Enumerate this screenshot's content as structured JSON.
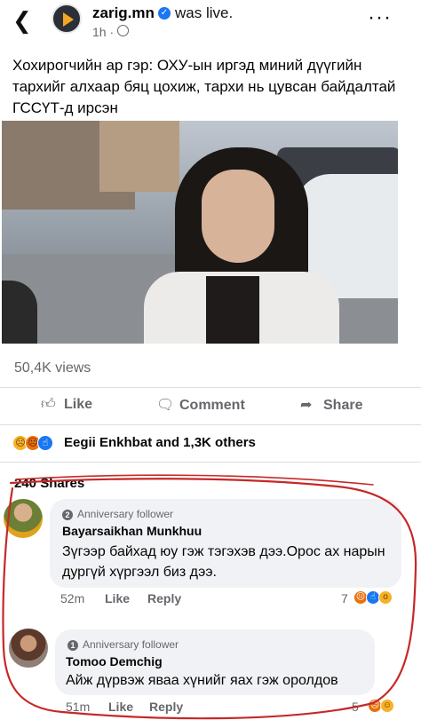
{
  "header": {
    "page_name": "zarig.mn",
    "status": "was live.",
    "time": "1h ·",
    "more": "···"
  },
  "post": {
    "text": "Хохирогчийн ар гэр: ОХУ-ын иргэд миний дүүгийн тархийг алхаар бяц цохиж, тархи нь цувсан байдалтай ГССҮТ-д ирсэн",
    "views": "50,4K views"
  },
  "actions": {
    "like": "Like",
    "comment": "Comment",
    "share": "Share"
  },
  "reactions": {
    "summary": "Eegii Enkhbat and 1,3K others",
    "shares": "240 Shares"
  },
  "comments": [
    {
      "badge": "Anniversary follower",
      "badge_num": "2",
      "author": "Bayarsaikhan Munkhuu",
      "text": "Зүгээр байхад юу гэж тэгэхэв дээ.Орос ах нарын дургүй хүргээл биз дээ.",
      "time": "52m",
      "like": "Like",
      "reply": "Reply",
      "reaction_count": "7"
    },
    {
      "badge": "Anniversary follower",
      "badge_num": "1",
      "author": "Tomoo Demchig",
      "text": "Айж дүрвэж яваа хүнийг яах гэж оролдов",
      "time": "51m",
      "like": "Like",
      "reply": "Reply",
      "reaction_count": "5"
    }
  ],
  "colors": {
    "accent": "#1877f2",
    "annotation_red": "#c62828",
    "muted_text": "#65676b"
  },
  "icons": [
    "back-arrow-icon",
    "play-logo-icon",
    "verified-badge-icon",
    "globe-icon",
    "more-icon",
    "expand-icon",
    "thumbs-up-icon",
    "comment-bubble-icon",
    "share-arrow-icon",
    "sad-reaction-icon",
    "angry-reaction-icon",
    "like-reaction-icon",
    "haha-reaction-icon",
    "wow-reaction-icon"
  ]
}
